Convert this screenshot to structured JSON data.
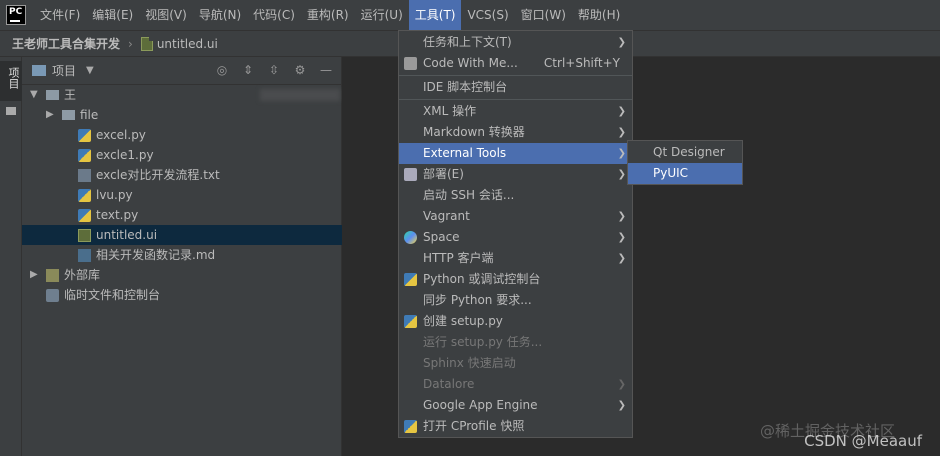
{
  "app": {
    "logo_text": "PC"
  },
  "menubar": {
    "items": [
      "文件(F)",
      "编辑(E)",
      "视图(V)",
      "导航(N)",
      "代码(C)",
      "重构(R)",
      "运行(U)",
      "工具(T)",
      "VCS(S)",
      "窗口(W)",
      "帮助(H)"
    ],
    "active_index": 7
  },
  "navbar": {
    "project": "王老师工具合集开发",
    "file": "untitled.ui"
  },
  "toolstrip": {
    "tab_label": "项目"
  },
  "project_panel": {
    "title": "项目",
    "root_label": "王",
    "tree": [
      {
        "label": "file",
        "type": "folder",
        "arrow": "right",
        "indent": 1
      },
      {
        "label": "excel.py",
        "type": "py",
        "indent": 2
      },
      {
        "label": "excle1.py",
        "type": "py",
        "indent": 2
      },
      {
        "label": "excle对比开发流程.txt",
        "type": "txt",
        "indent": 2
      },
      {
        "label": "lvu.py",
        "type": "py",
        "indent": 2
      },
      {
        "label": "text.py",
        "type": "py",
        "indent": 2
      },
      {
        "label": "untitled.ui",
        "type": "ui",
        "indent": 2,
        "selected": true
      },
      {
        "label": "相关开发函数记录.md",
        "type": "md",
        "indent": 2
      },
      {
        "label": "外部库",
        "type": "lib",
        "arrow": "right",
        "indent": 0
      },
      {
        "label": "临时文件和控制台",
        "type": "scratch",
        "indent": 0
      }
    ]
  },
  "tools_menu": {
    "items": [
      {
        "label": "任务和上下文(T)",
        "submenu": true
      },
      {
        "label": "Code With Me...",
        "shortcut": "Ctrl+Shift+Y",
        "icon": "user-icon",
        "sep_after": true
      },
      {
        "label": "IDE 脚本控制台",
        "sep_after": true
      },
      {
        "label": "XML 操作",
        "submenu": true
      },
      {
        "label": "Markdown 转换器",
        "submenu": true
      },
      {
        "label": "External Tools",
        "submenu": true,
        "highlighted": true
      },
      {
        "label": "部署(E)",
        "submenu": true,
        "icon": "deploy-icon"
      },
      {
        "label": "启动 SSH 会话..."
      },
      {
        "label": "Vagrant",
        "submenu": true
      },
      {
        "label": "Space",
        "submenu": true,
        "icon": "space-icon"
      },
      {
        "label": "HTTP 客户端",
        "submenu": true
      },
      {
        "label": "Python 或调试控制台",
        "icon": "python-icon"
      },
      {
        "label": "同步 Python 要求..."
      },
      {
        "label": "创建 setup.py",
        "icon": "python-icon"
      },
      {
        "label": "运行 setup.py 任务...",
        "disabled": true
      },
      {
        "label": "Sphinx 快速启动",
        "disabled": true
      },
      {
        "label": "Datalore",
        "submenu": true,
        "disabled": true
      },
      {
        "label": "Google App Engine",
        "submenu": true
      },
      {
        "label": "打开 CProfile 快照",
        "icon": "python-icon"
      }
    ]
  },
  "external_tools_submenu": {
    "items": [
      {
        "label": "Qt Designer"
      },
      {
        "label": "PyUIC",
        "highlighted": true
      }
    ]
  },
  "watermark": {
    "text": "CSDN @Meaauf",
    "text2": "@稀土掘金技术社区"
  },
  "colors": {
    "accent": "#4b6eaf",
    "menu_bg": "#3c3f41",
    "editor_bg": "#2b2b2b",
    "selected_row": "#0d293e"
  }
}
